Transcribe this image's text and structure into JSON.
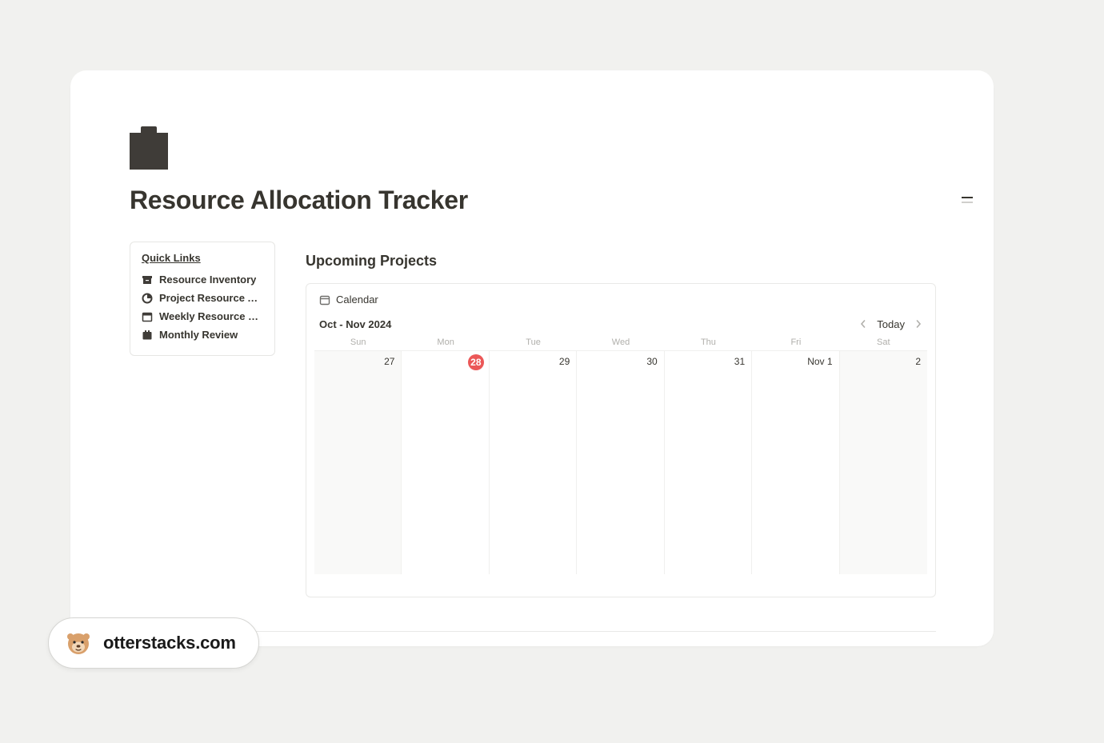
{
  "page": {
    "title": "Resource Allocation Tracker"
  },
  "quick_links": {
    "heading": "Quick Links",
    "items": [
      {
        "icon": "archive-box-icon",
        "label": "Resource Inventory"
      },
      {
        "icon": "pie-chart-icon",
        "label": "Project Resource Alloc..."
      },
      {
        "icon": "calendar-icon",
        "label": "Weekly Resource Plan..."
      },
      {
        "icon": "calendar-clip-icon",
        "label": "Monthly Review"
      }
    ]
  },
  "upcoming": {
    "heading": "Upcoming Projects",
    "tab_label": "Calendar",
    "range_label": "Oct - Nov 2024",
    "today_label": "Today",
    "weekdays": [
      "Sun",
      "Mon",
      "Tue",
      "Wed",
      "Thu",
      "Fri",
      "Sat"
    ],
    "days": [
      {
        "label": "27",
        "today": false,
        "shaded": true
      },
      {
        "label": "28",
        "today": true,
        "shaded": false
      },
      {
        "label": "29",
        "today": false,
        "shaded": false
      },
      {
        "label": "30",
        "today": false,
        "shaded": false
      },
      {
        "label": "31",
        "today": false,
        "shaded": false
      },
      {
        "label": "Nov 1",
        "today": false,
        "shaded": false
      },
      {
        "label": "2",
        "today": false,
        "shaded": true
      }
    ]
  },
  "brand": {
    "text": "otterstacks.com"
  }
}
